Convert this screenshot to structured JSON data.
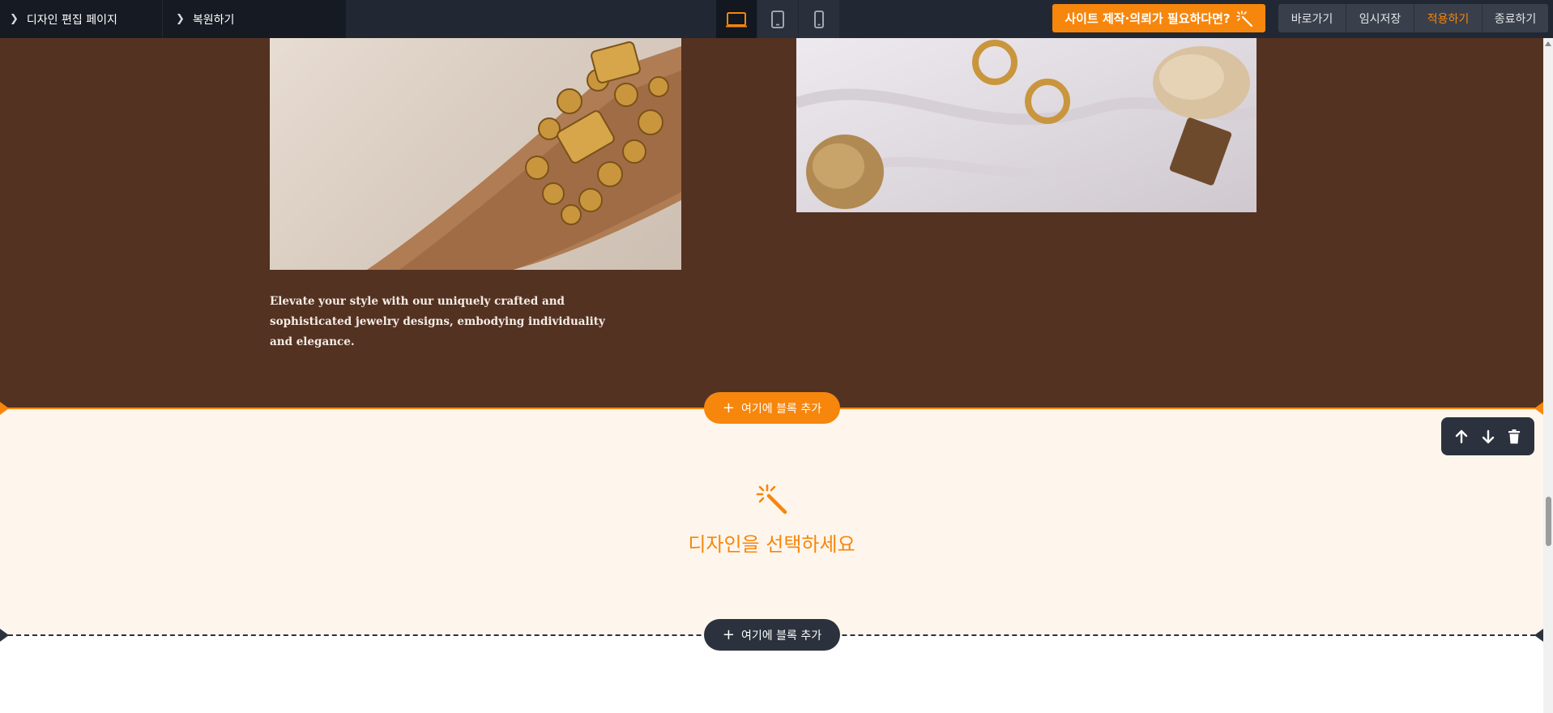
{
  "toolbar": {
    "design_edit_page": "디자인 편집 페이지",
    "restore": "복원하기",
    "devices": [
      "desktop",
      "tablet",
      "mobile"
    ],
    "active_device": "desktop",
    "cta_label": "사이트 제작·의뢰가 필요하다면?",
    "buttons": {
      "go": "바로가기",
      "temp_save": "임시저장",
      "apply": "적용하기",
      "exit": "종료하기"
    }
  },
  "content": {
    "photo_left": "bracelet-photo",
    "photo_right": "rings-photo",
    "description": "Elevate your style with our uniquely crafted and sophisticated jewelry designs, embodying individuality and elegance."
  },
  "editor": {
    "add_block_label": "여기에 블록 추가",
    "choose_design": "디자인을 선택하세요",
    "block_controls": [
      "arrow-up-icon",
      "arrow-down-icon",
      "trash-icon"
    ]
  },
  "colors": {
    "accent": "#f7860c",
    "toolbar_bg": "#222833",
    "section_brown": "#533222",
    "section_cream": "#fef6ec",
    "dark_pill": "#2c323d"
  }
}
